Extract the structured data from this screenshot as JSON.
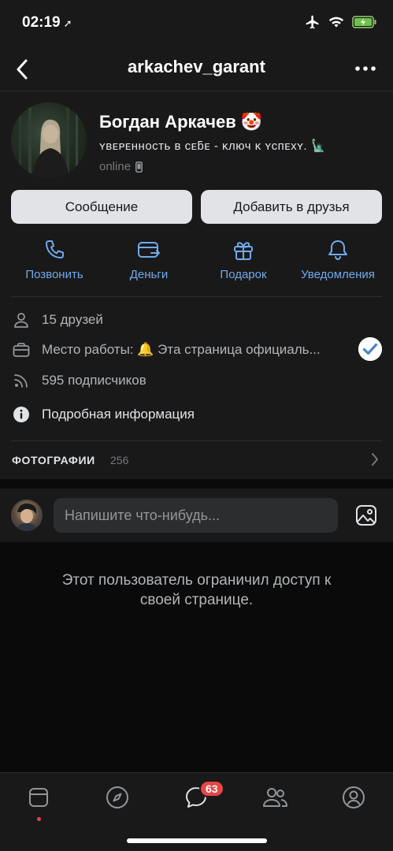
{
  "status_bar": {
    "time": "02:19",
    "icons": [
      "location-arrow-icon",
      "airplane-icon",
      "wifi-icon",
      "battery-charging-icon"
    ]
  },
  "nav": {
    "title": "arkachev_garant",
    "back_icon": "back-chevron-icon",
    "more_icon": "more-dots-icon"
  },
  "profile": {
    "name": "Богдан Аркачев 🤡",
    "status": "ʏвᴇᴘᴇнность ʙ ᴄᴇƃᴇ - ᴋлюч ᴋ ʏᴄпᴇхʏ. 🗽",
    "online": "online"
  },
  "buttons": {
    "message": "Сообщение",
    "add_friend": "Добавить в друзья"
  },
  "actions": [
    {
      "label": "Позвонить",
      "icon": "phone-icon"
    },
    {
      "label": "Деньги",
      "icon": "money-transfer-icon"
    },
    {
      "label": "Подарок",
      "icon": "gift-icon"
    },
    {
      "label": "Уведомления",
      "icon": "bell-icon"
    }
  ],
  "info": {
    "friends": "15 друзей",
    "work": "Место работы: 🔔 Эта страница официаль...",
    "followers": "595 подписчиков",
    "details": "Подробная информация"
  },
  "photos": {
    "title": "ФОТОГРАФИИ",
    "count": "256"
  },
  "post": {
    "placeholder": "Напишите что-нибудь..."
  },
  "restricted": {
    "line1": "Этот пользователь ограничил доступ к",
    "line2": "своей странице."
  },
  "tab_bar": {
    "tabs": [
      "news-icon",
      "discover-icon",
      "messages-icon",
      "friends-icon",
      "profile-icon"
    ],
    "messages_badge": "63"
  },
  "colors": {
    "accent": "#71aaeb",
    "background": "#19191a",
    "badge": "#e64646"
  }
}
